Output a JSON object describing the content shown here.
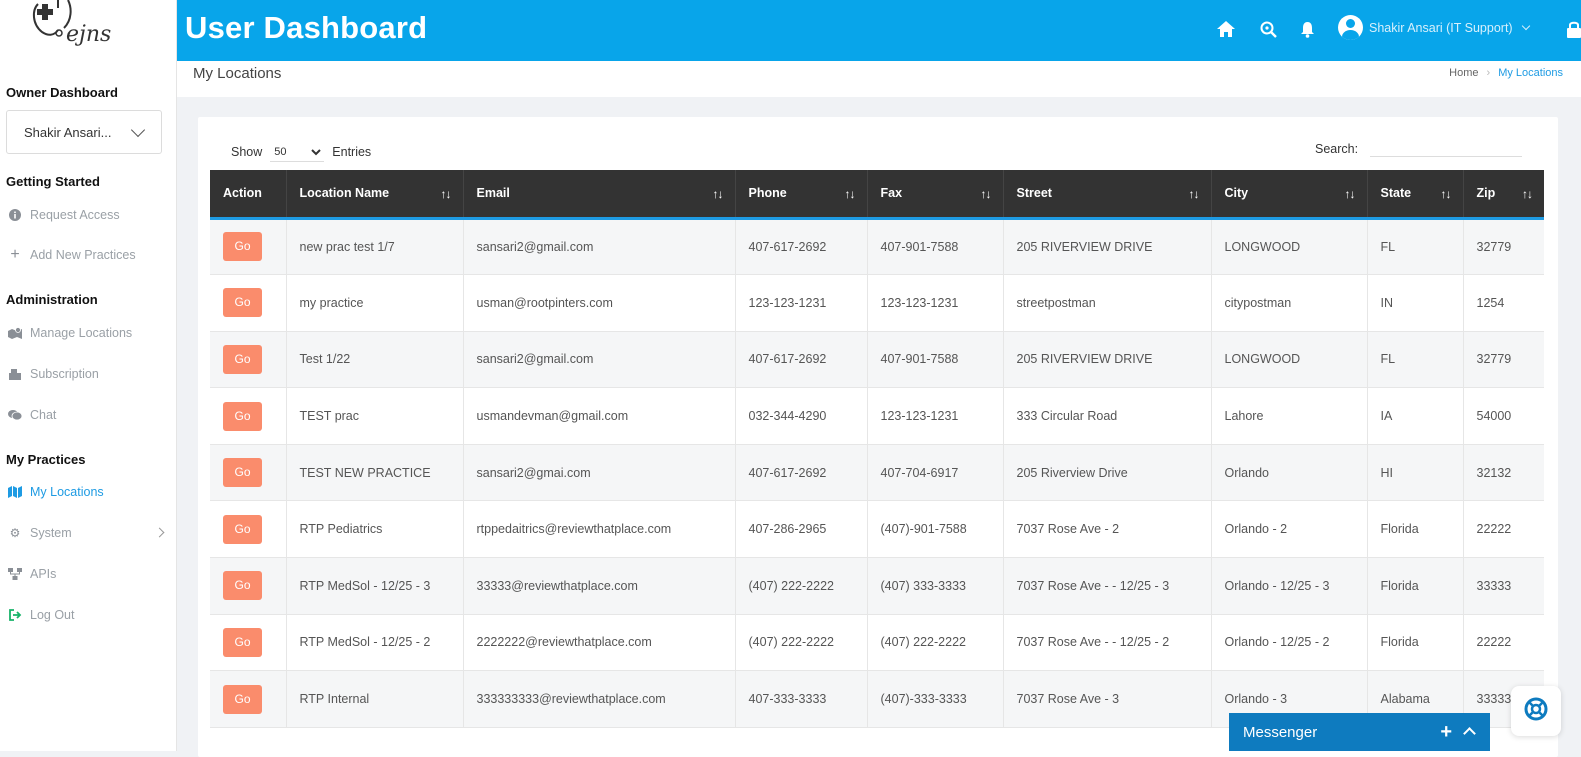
{
  "sidebar": {
    "logo_text": "ejns",
    "owner_heading": "Owner Dashboard",
    "owner_select": "Shakir Ansari...",
    "getting_started": "Getting Started",
    "request_access": "Request Access",
    "add_new_practices": "Add New Practices",
    "administration": "Administration",
    "manage_locations": "Manage Locations",
    "subscription": "Subscription",
    "chat": "Chat",
    "my_practices": "My Practices",
    "my_locations": "My Locations",
    "system": "System",
    "apis": "APIs",
    "log_out": "Log Out"
  },
  "header": {
    "title": "User Dashboard",
    "user": "Shakir Ansari (IT Support)",
    "icons": [
      "home-icon",
      "search-icon",
      "bell-icon",
      "lock-icon"
    ]
  },
  "breadcrumb": {
    "page_title": "My Locations",
    "home": "Home",
    "current": "My Locations"
  },
  "table_controls": {
    "show_label": "Show",
    "entries_value": "50",
    "entries_label": "Entries",
    "search_label": "Search:"
  },
  "table": {
    "headers": [
      "Action",
      "Location Name",
      "Email",
      "Phone",
      "Fax",
      "Street",
      "City",
      "State",
      "Zip"
    ],
    "action_label": "Go",
    "rows": [
      [
        "new prac test 1/7",
        "sansari2@gmail.com",
        "407-617-2692",
        "407-901-7588",
        "205 RIVERVIEW DRIVE",
        "LONGWOOD",
        "FL",
        "32779"
      ],
      [
        "my practice",
        "usman@rootpinters.com",
        "123-123-1231",
        "123-123-1231",
        "streetpostman",
        "citypostman",
        "IN",
        "1254"
      ],
      [
        "Test 1/22",
        "sansari2@gmail.com",
        "407-617-2692",
        "407-901-7588",
        "205 RIVERVIEW DRIVE",
        "LONGWOOD",
        "FL",
        "32779"
      ],
      [
        "TEST prac",
        "usmandevman@gmail.com",
        "032-344-4290",
        "123-123-1231",
        "333 Circular Road",
        "Lahore",
        "IA",
        "54000"
      ],
      [
        "TEST NEW PRACTICE",
        "sansari2@gmai.com",
        "407-617-2692",
        "407-704-6917",
        "205 Riverview Drive",
        "Orlando",
        "HI",
        "32132"
      ],
      [
        "RTP Pediatrics",
        "rtppedaitrics@reviewthatplace.com",
        "407-286-2965",
        "(407)-901-7588",
        "7037 Rose Ave - 2",
        "Orlando - 2",
        "Florida",
        "22222"
      ],
      [
        "RTP MedSol - 12/25 - 3",
        "33333@reviewthatplace.com",
        "(407) 222-2222",
        "(407) 333-3333",
        "7037 Rose Ave - - 12/25 - 3",
        "Orlando - 12/25 - 3",
        "Florida",
        "33333"
      ],
      [
        "RTP MedSol - 12/25 - 2",
        "2222222@reviewthatplace.com",
        "(407) 222-2222",
        "(407) 222-2222",
        "7037 Rose Ave - - 12/25 - 2",
        "Orlando - 12/25 - 2",
        "Florida",
        "22222"
      ],
      [
        "RTP Internal",
        "333333333@reviewthatplace.com",
        "407-333-3333",
        "(407)-333-3333",
        "7037 Rose Ave - 3",
        "Orlando - 3",
        "Alabama",
        "33333"
      ]
    ]
  },
  "messenger": {
    "label": "Messenger"
  },
  "colors": {
    "header_blue": "#08a5ea",
    "accent_blue": "#1e9be3",
    "go_button": "#fa8c6c",
    "table_head": "#333333",
    "messenger": "#0e7bbf"
  }
}
